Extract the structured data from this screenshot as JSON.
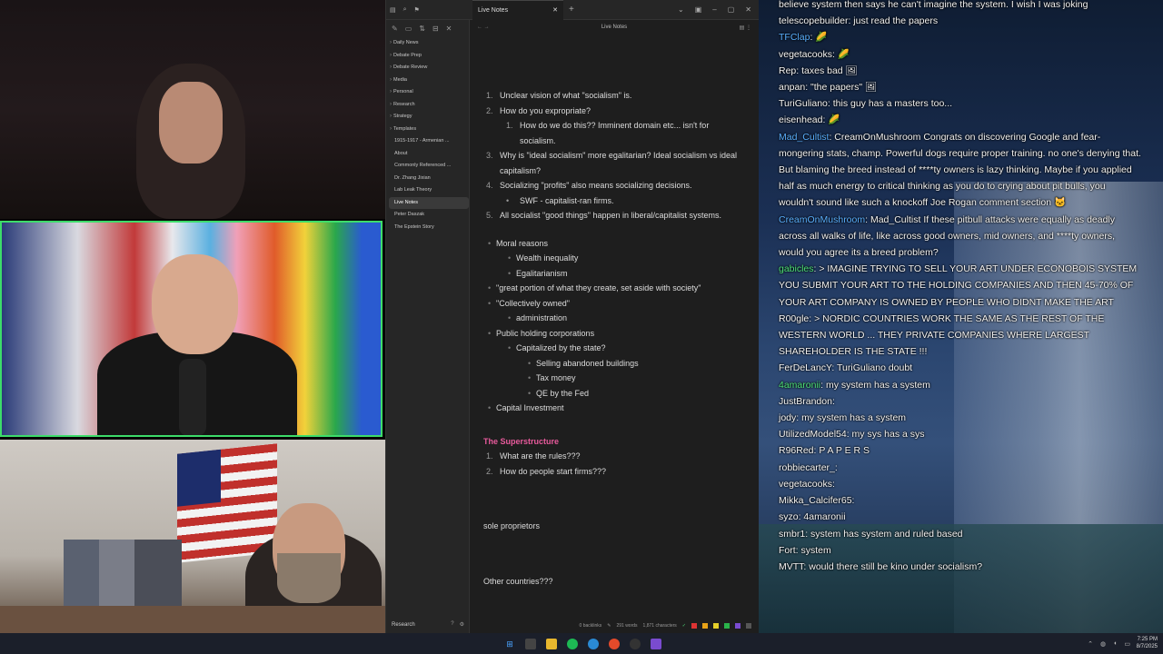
{
  "app": {
    "tab_title": "Live Notes",
    "note_title": "Live Notes",
    "sidebar_items": [
      {
        "label": "Daily News",
        "folder": true
      },
      {
        "label": "Debate Prep",
        "folder": true
      },
      {
        "label": "Debate Review",
        "folder": true
      },
      {
        "label": "Media",
        "folder": true
      },
      {
        "label": "Personal",
        "folder": true
      },
      {
        "label": "Research",
        "folder": true
      },
      {
        "label": "Strategy",
        "folder": true
      },
      {
        "label": "Templates",
        "folder": true
      },
      {
        "label": "1915-1917 - Armenian ...",
        "folder": false
      },
      {
        "label": "About",
        "folder": false
      },
      {
        "label": "Commonly Referenced ...",
        "folder": false
      },
      {
        "label": "Dr. Zhang Jixian",
        "folder": false
      },
      {
        "label": "Lab Leak Theory",
        "folder": false
      },
      {
        "label": "Live Notes",
        "folder": false,
        "active": true
      },
      {
        "label": "Peter Daszak",
        "folder": false
      },
      {
        "label": "The Epstein Story",
        "folder": false
      }
    ],
    "vault_name": "Research",
    "status": {
      "backlinks": "0 backlinks",
      "words": "291 words",
      "characters": "1,871 characters"
    }
  },
  "note": {
    "numbered": [
      {
        "n": "1.",
        "text": "Unclear vision of what \"socialism\" is."
      },
      {
        "n": "2.",
        "text": "How do you expropriate?"
      },
      {
        "n": "1.",
        "text": "How do we do this?? Imminent domain etc... isn't for socialism.",
        "sub": true
      },
      {
        "n": "3.",
        "text": "Why is \"ideal socialism\" more egalitarian? Ideal socialism vs ideal capitalism?"
      },
      {
        "n": "4.",
        "text": "Socializing \"profits\" also means socializing decisions."
      },
      {
        "n": "",
        "text": "SWF - capitalist-ran firms.",
        "sub": true,
        "bullet": true
      },
      {
        "n": "5.",
        "text": "All socialist \"good things\" happen in liberal/capitalist systems."
      }
    ],
    "bullets": [
      {
        "text": "Moral reasons",
        "level": 1
      },
      {
        "text": "Wealth inequality",
        "level": 2
      },
      {
        "text": "Egalitarianism",
        "level": 2
      },
      {
        "text": "\"great portion of what they create, set aside with society\"",
        "level": 1
      },
      {
        "text": "\"Collectively owned\"",
        "level": 1
      },
      {
        "text": "administration",
        "level": 2
      },
      {
        "text": "Public holding corporations",
        "level": 1
      },
      {
        "text": "Capitalized by the state?",
        "level": 2
      },
      {
        "text": "Selling abandoned buildings",
        "level": 3
      },
      {
        "text": "Tax money",
        "level": 3
      },
      {
        "text": "QE by the Fed",
        "level": 3
      },
      {
        "text": "Capital Investment",
        "level": 1
      }
    ],
    "heading": "The Superstructure",
    "superstructure": [
      {
        "n": "1.",
        "text": "What are the rules???"
      },
      {
        "n": "2.",
        "text": "How do people start firms???"
      }
    ],
    "line_a": "sole proprietors",
    "line_b": "Other countries???"
  },
  "chat": [
    {
      "user": "",
      "text": "believe system then says he can't imagine the system. I wish I was joking",
      "color": "white"
    },
    {
      "user": "telescopebuilder",
      "text": ": just read the papers",
      "color": "white"
    },
    {
      "user": "TFClap",
      "text": ": 🌽",
      "color": "blue"
    },
    {
      "user": "vegetacooks",
      "text": ": 🌽",
      "color": "white"
    },
    {
      "user": "Rep",
      "text": ": taxes bad 🖼",
      "color": "white"
    },
    {
      "user": "anpan",
      "text": ": \"the papers\" 🖼",
      "color": "white"
    },
    {
      "user": "TuriGuliano",
      "text": ": this guy has a masters too...",
      "color": "white"
    },
    {
      "user": "eisenhead",
      "text": ": 🌽",
      "color": "white"
    },
    {
      "user": "Mad_Cultist",
      "text": ": CreamOnMushroom Congrats on discovering Google and fear-mongering stats, champ. Powerful dogs require proper training. no one's denying that. But blaming the breed instead of ****ty owners is lazy thinking. Maybe if you applied half as much energy to critical thinking as you do to crying about pit bulls, you wouldn't sound like such a knockoff Joe Rogan comment section 🐱",
      "color": "blue"
    },
    {
      "user": "CreamOnMushroom",
      "text": ": Mad_Cultist If these pitbull attacks were equally as deadly across all walks of life, like across good owners, mid owners, and ****ty owners, would you agree its a breed problem?",
      "color": "blue"
    },
    {
      "user": "gabicles",
      "text": ": > IMAGINE TRYING TO SELL YOUR ART UNDER ECONOBOIS SYSTEM YOU SUBMIT YOUR ART TO THE HOLDING COMPANIES AND THEN 45-70% OF YOUR ART COMPANY IS OWNED BY PEOPLE WHO DIDNT MAKE THE ART",
      "color": "green"
    },
    {
      "user": "R00gle",
      "text": ": > NORDIC COUNTRIES WORK THE SAME AS THE REST OF THE WESTERN WORLD ... THEY PRIVATE COMPANIES WHERE LARGEST SHAREHOLDER IS THE STATE !!!",
      "color": "white"
    },
    {
      "user": "FerDeLancY",
      "text": ": TuriGuliano doubt",
      "color": "white"
    },
    {
      "user": "4amaronii",
      "text": ": my system has a system",
      "color": "green"
    },
    {
      "user": "JustBrandon",
      "text": ":",
      "color": "white"
    },
    {
      "user": "jody",
      "text": ": my system has a system",
      "color": "white"
    },
    {
      "user": "UtilizedModel54",
      "text": ": my sys has a sys",
      "color": "white"
    },
    {
      "user": "R96Red",
      "text": ": P A P E R S",
      "color": "white"
    },
    {
      "user": "robbiecarter_",
      "text": ":",
      "color": "white"
    },
    {
      "user": "vegetacooks",
      "text": ":",
      "color": "white"
    },
    {
      "user": "Mikka_Calcifer65",
      "text": ":",
      "color": "white"
    },
    {
      "user": "syzo",
      "text": ": 4amaronii",
      "color": "white"
    },
    {
      "user": "smbr1",
      "text": ": system has system and ruled based",
      "color": "white"
    },
    {
      "user": "Fort",
      "text": ": system",
      "color": "white"
    },
    {
      "user": "MVTT",
      "text": ": would there still be kino under socialism?",
      "color": "white"
    }
  ],
  "taskbar": {
    "time": "7:25 PM",
    "date": "8/7/2025"
  }
}
